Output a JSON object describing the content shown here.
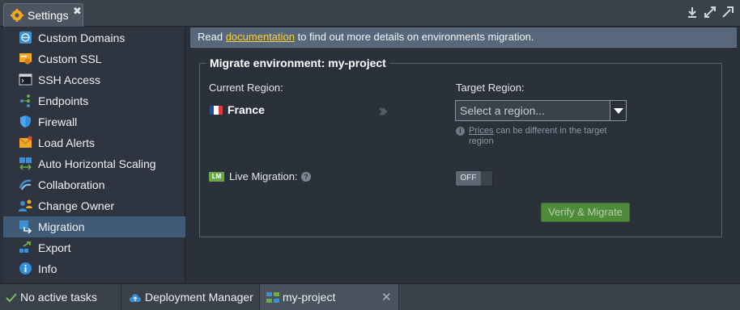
{
  "window": {
    "tab_title": "Settings",
    "tab_close": "✖",
    "icons": [
      "download-icon",
      "expand-icon",
      "popout-icon"
    ]
  },
  "sidebar": {
    "items": [
      {
        "label": "Custom Domains",
        "icon": "globe-icon"
      },
      {
        "label": "Custom SSL",
        "icon": "certificate-icon"
      },
      {
        "label": "SSH Access",
        "icon": "terminal-icon"
      },
      {
        "label": "Endpoints",
        "icon": "endpoints-icon"
      },
      {
        "label": "Firewall",
        "icon": "shield-icon"
      },
      {
        "label": "Load Alerts",
        "icon": "mail-alert-icon"
      },
      {
        "label": "Auto Horizontal Scaling",
        "icon": "scaling-icon"
      },
      {
        "label": "Collaboration",
        "icon": "collaboration-icon"
      },
      {
        "label": "Change Owner",
        "icon": "change-owner-icon"
      },
      {
        "label": "Migration",
        "icon": "migration-icon"
      },
      {
        "label": "Export",
        "icon": "export-icon"
      },
      {
        "label": "Info",
        "icon": "info-icon"
      }
    ],
    "active_index": 9
  },
  "infobar": {
    "prefix": "Read ",
    "link": "documentation",
    "suffix": " to find out more details on environments migration."
  },
  "migrate": {
    "legend": "Migrate environment: my-project",
    "current_region_label": "Current Region:",
    "current_region": "France",
    "target_region_label": "Target Region:",
    "target_placeholder": "Select a region...",
    "hint_link": "Prices",
    "hint_text": " can be different in the target region",
    "live_migration_badge": "LM",
    "live_migration_label": "Live Migration:",
    "toggle_label": "OFF",
    "verify_button": "Verify & Migrate"
  },
  "bottom": {
    "tasks": "No active tasks",
    "deployment_manager": "Deployment Manager",
    "project": "my-project"
  },
  "colors": {
    "accent_active": "#415a75",
    "link": "#f5d23a",
    "verify_button": "#4d8b3a",
    "lm_badge": "#68a849"
  }
}
